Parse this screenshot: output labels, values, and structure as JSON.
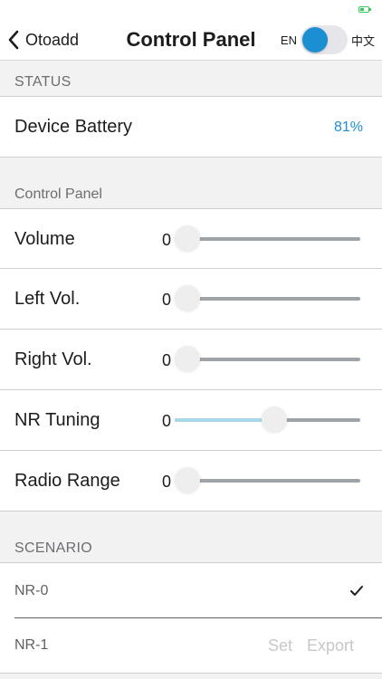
{
  "statusbar": {
    "battery_color": "#34c759"
  },
  "nav": {
    "back_label": "Otoadd",
    "title": "Control Panel",
    "lang_en": "EN",
    "lang_zh": "中文",
    "toggle_color": "#1b8fd2"
  },
  "status": {
    "header": "STATUS",
    "battery_label": "Device Battery",
    "battery_value": "81%"
  },
  "control": {
    "header": "Control Panel",
    "sliders": [
      {
        "label": "Volume",
        "value": "0",
        "level": 0.0
      },
      {
        "label": "Left Vol.",
        "value": "0",
        "level": 0.0
      },
      {
        "label": "Right Vol.",
        "value": "0",
        "level": 0.0
      },
      {
        "label": "NR Tuning",
        "value": "0",
        "level": 0.5
      },
      {
        "label": "Radio Range",
        "value": "0",
        "level": 0.0
      }
    ]
  },
  "scenario": {
    "header": "SCENARIO",
    "items": [
      {
        "label": "NR-0",
        "selected": true
      },
      {
        "label": "NR-1",
        "selected": false,
        "set_label": "Set",
        "export_label": "Export"
      }
    ]
  }
}
